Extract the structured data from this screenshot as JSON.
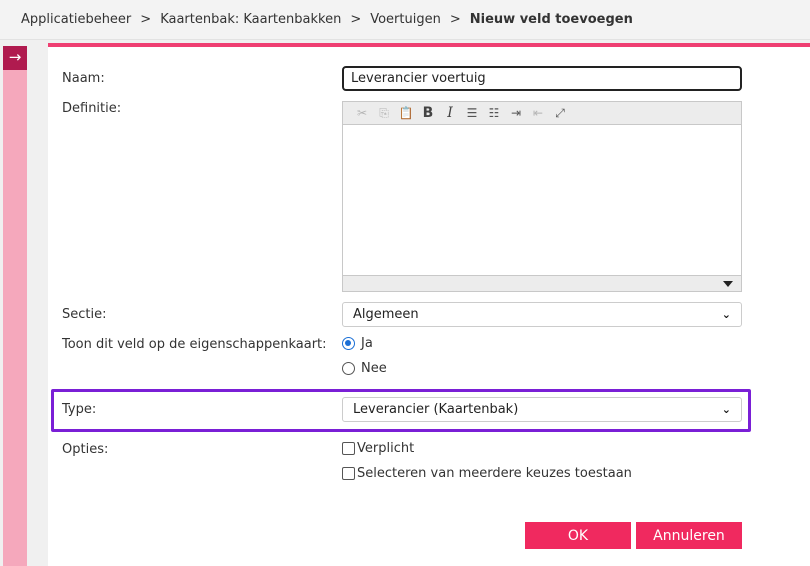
{
  "breadcrumb": {
    "items": [
      "Applicatiebeheer",
      "Kaartenbak: Kaartenbakken",
      "Voertuigen"
    ],
    "separator": ">",
    "current": "Nieuw veld toevoegen"
  },
  "rail": {
    "icon": "arrow-right-icon",
    "glyph": "→"
  },
  "form": {
    "naam": {
      "label": "Naam:",
      "value": "Leverancier voertuig"
    },
    "definitie": {
      "label": "Definitie:",
      "value": ""
    },
    "sectie": {
      "label": "Sectie:",
      "selected": "Algemeen"
    },
    "toon": {
      "label": "Toon dit veld op de eigenschappenkaart:",
      "options": [
        {
          "label": "Ja",
          "checked": true
        },
        {
          "label": "Nee",
          "checked": false
        }
      ]
    },
    "type": {
      "label": "Type:",
      "selected": "Leverancier (Kaartenbak)"
    },
    "opties": {
      "label": "Opties:",
      "options": [
        {
          "label": "Verplicht",
          "checked": false
        },
        {
          "label": "Selecteren van meerdere keuzes toestaan",
          "checked": false
        }
      ]
    }
  },
  "editor_toolbar": [
    "cut-icon",
    "copy-icon",
    "paste-icon",
    "bold-icon",
    "italic-icon",
    "numbered-list-icon",
    "bullet-list-icon",
    "indent-icon",
    "outdent-icon",
    "maximize-icon"
  ],
  "buttons": {
    "ok": "OK",
    "cancel": "Annuleren"
  },
  "colors": {
    "accent": "#f0295f",
    "rail": "#f5a8bc",
    "rail_button": "#b01b4f",
    "highlight": "#7a1fd6",
    "radio": "#1a6fd6"
  }
}
